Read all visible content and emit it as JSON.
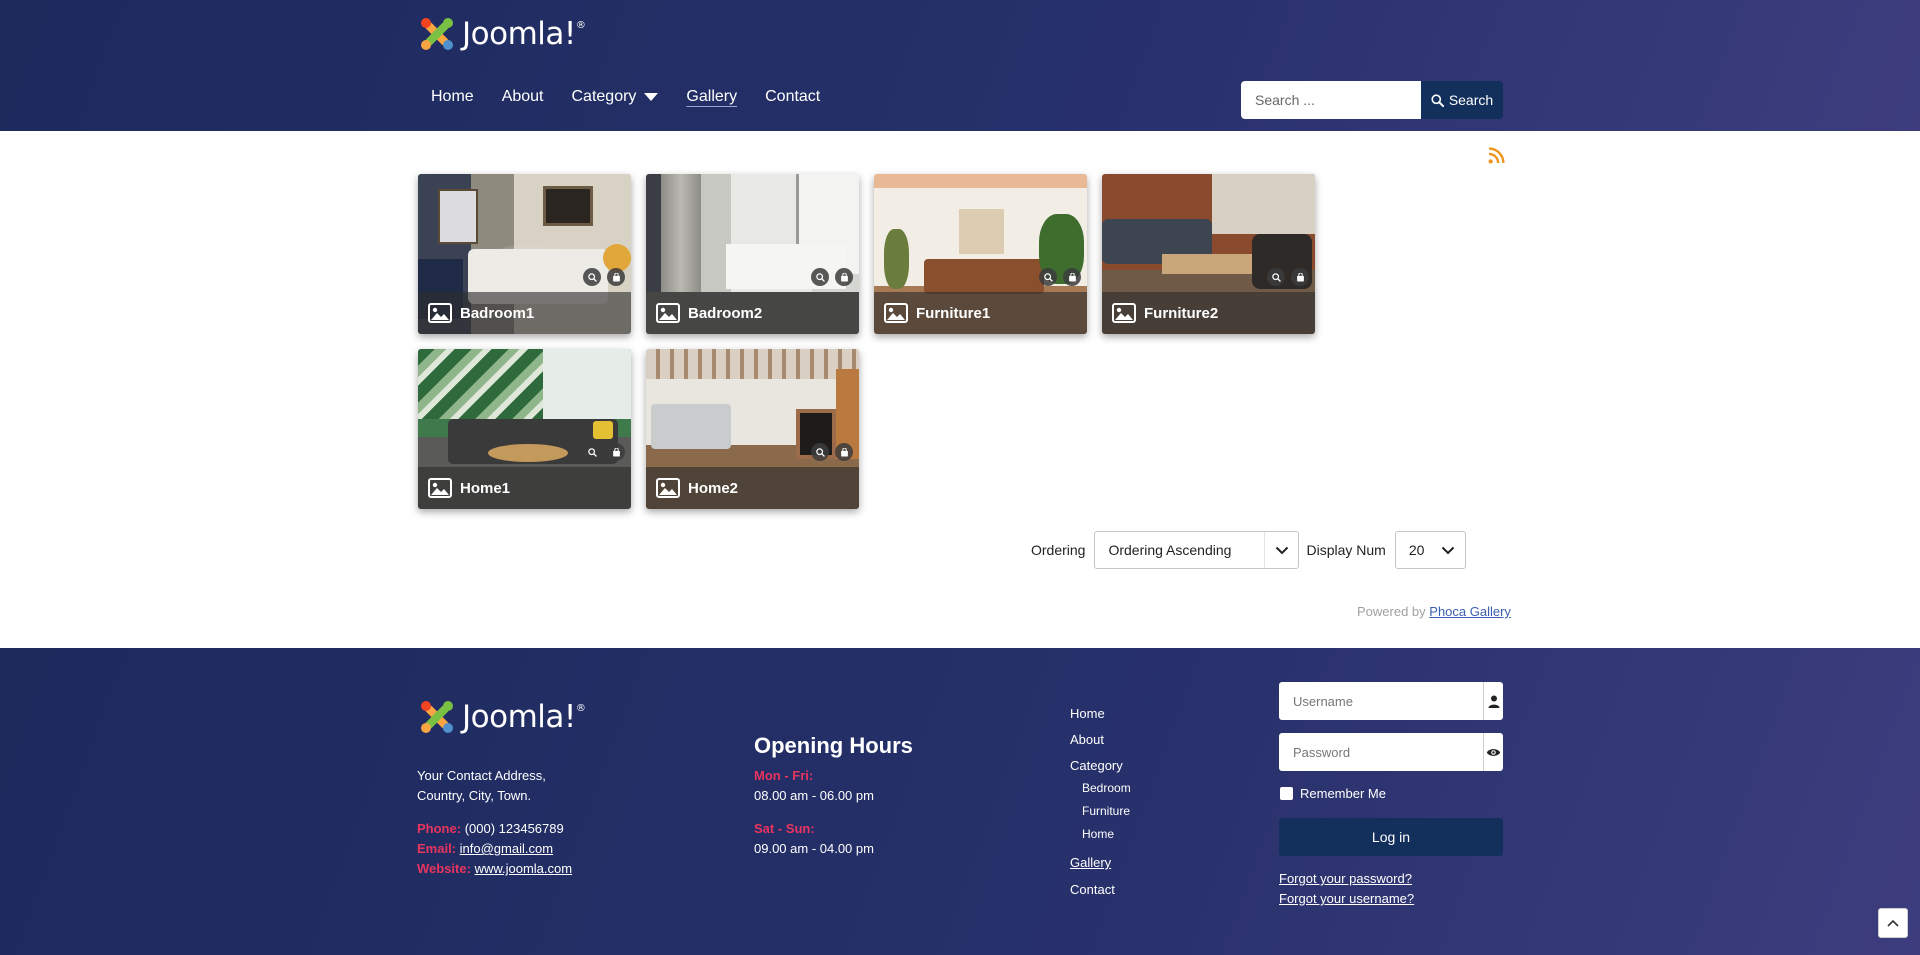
{
  "header": {
    "logo_text": "Joomla!",
    "nav": [
      {
        "label": "Home"
      },
      {
        "label": "About"
      },
      {
        "label": "Category"
      },
      {
        "label": "Gallery"
      },
      {
        "label": "Contact"
      }
    ],
    "search": {
      "placeholder": "Search ...",
      "button_label": "Search"
    }
  },
  "gallery": {
    "items": [
      {
        "title": "Badroom1"
      },
      {
        "title": "Badroom2"
      },
      {
        "title": "Furniture1"
      },
      {
        "title": "Furniture2"
      },
      {
        "title": "Home1"
      },
      {
        "title": "Home2"
      }
    ]
  },
  "ordering": {
    "label": "Ordering",
    "value": "Ordering Ascending",
    "display_num_label": "Display Num",
    "display_num_value": "20"
  },
  "powered": {
    "prefix": "Powered by",
    "link": "Phoca Gallery"
  },
  "footer": {
    "logo_text": "Joomla!",
    "address_line1": "Your Contact Address,",
    "address_line2": "Country, City, Town.",
    "phone_label": "Phone:",
    "phone_value": "(000) 123456789",
    "email_label": "Email:",
    "email_value": "info@gmail.com",
    "website_label": "Website:",
    "website_value": "www.joomla.com",
    "hours_title": "Opening Hours",
    "weekday_label": "Mon - Fri:",
    "weekday_hours": "08.00 am - 06.00 pm",
    "weekend_label": "Sat - Sun:",
    "weekend_hours": "09.00 am - 04.00 pm",
    "menu": {
      "home": "Home",
      "about": "About",
      "category": "Category",
      "sub": [
        "Bedroom",
        "Furniture",
        "Home"
      ],
      "gallery": "Gallery",
      "contact": "Contact"
    },
    "login": {
      "username_placeholder": "Username",
      "password_placeholder": "Password",
      "remember_label": "Remember Me",
      "button_label": "Log in",
      "forgot_password": "Forgot your password?",
      "forgot_username": "Forgot your username?"
    }
  },
  "colors": {
    "header_bg": "#1c2a5c",
    "accent_button": "#132f5c",
    "pink_label": "#e8345f",
    "rss": "#f0931c"
  }
}
